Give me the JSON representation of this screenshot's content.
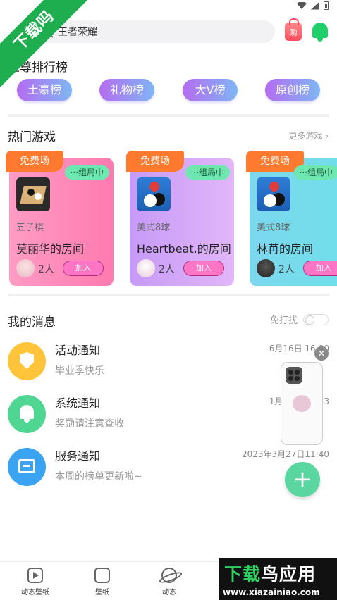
{
  "watermark": {
    "corner_text": "下载吗",
    "brand_title_a": "下载",
    "brand_title_b": "鸟应用",
    "brand_url": "www.xiazainiao.com"
  },
  "search": {
    "value": "王者荣耀"
  },
  "header": {
    "shop_label": "购"
  },
  "ranking": {
    "title": "至尊排行榜",
    "pills": [
      "土豪榜",
      "礼物榜",
      "大V榜",
      "原创榜"
    ]
  },
  "games": {
    "title": "热门游戏",
    "more_label": "更多游戏",
    "cards": [
      {
        "tag": "免费场",
        "status": "···组局中",
        "game": "五子棋",
        "room": "莫丽华的房间",
        "count": "2人",
        "join": "加入"
      },
      {
        "tag": "免费场",
        "status": "···组局中",
        "game": "美式8球",
        "room": "Heartbeat.的房间",
        "count": "2人",
        "join": "加入"
      },
      {
        "tag": "免费场",
        "status": "···组局中",
        "game": "美式8球",
        "room": "林苒的房间",
        "count": "2人",
        "join": "加入"
      }
    ]
  },
  "messages": {
    "title": "我的消息",
    "dnd_label": "免打扰",
    "items": [
      {
        "title": "活动通知",
        "subtitle": "毕业季快乐",
        "time": "6月16日 16:00"
      },
      {
        "title": "系统通知",
        "subtitle": "奖励请注意查收",
        "time": "1月10日 09:23"
      },
      {
        "title": "服务通知",
        "subtitle": "本周的榜单更新啦~",
        "time": "2023年3月27日11:40"
      }
    ]
  },
  "float": {
    "close": "×",
    "fab": "+"
  },
  "nav": {
    "items": [
      "动态壁纸",
      "壁纸",
      "动态"
    ]
  },
  "colors": {
    "accent_green": "#1fae4f",
    "pill_gradient_start": "#b46cf0",
    "pill_gradient_end": "#7fb6f6",
    "tag_orange": "#ff7a2e",
    "join_pink": "#ff75c5"
  }
}
